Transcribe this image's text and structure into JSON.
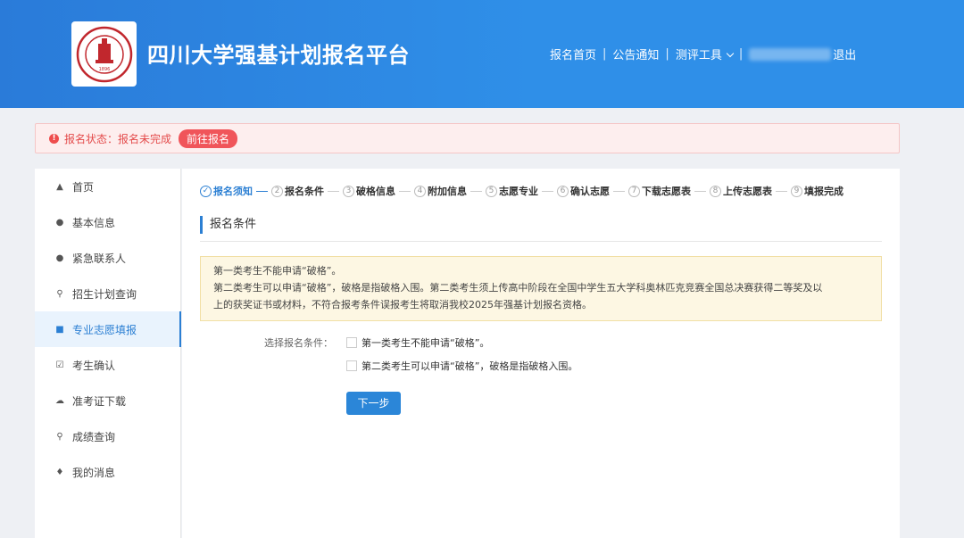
{
  "header": {
    "logo_seal_text": "四川大学 SICHUAN UNIVERSITY 1896",
    "site_title": "四川大学强基计划报名平台",
    "nav": {
      "home": "报名首页",
      "notice": "公告通知",
      "tools": "测评工具",
      "logout": "退出"
    }
  },
  "status": {
    "text": "报名状态：报名未完成",
    "action": "前往报名"
  },
  "sidebar": {
    "items": [
      {
        "label": "首页",
        "icon": "home-icon"
      },
      {
        "label": "基本信息",
        "icon": "user-icon"
      },
      {
        "label": "紧急联系人",
        "icon": "user-icon"
      },
      {
        "label": "招生计划查询",
        "icon": "search-icon"
      },
      {
        "label": "专业志愿填报",
        "icon": "document-icon",
        "active": true
      },
      {
        "label": "考生确认",
        "icon": "checkbox-icon"
      },
      {
        "label": "准考证下载",
        "icon": "cloud-download-icon"
      },
      {
        "label": "成绩查询",
        "icon": "search-icon"
      },
      {
        "label": "我的消息",
        "icon": "bell-icon"
      }
    ]
  },
  "steps": [
    {
      "label": "报名须知",
      "num": "✓",
      "state": "done"
    },
    {
      "label": "报名条件",
      "num": "2"
    },
    {
      "label": "破格信息",
      "num": "3"
    },
    {
      "label": "附加信息",
      "num": "4"
    },
    {
      "label": "志愿专业",
      "num": "5"
    },
    {
      "label": "确认志愿",
      "num": "6"
    },
    {
      "label": "下载志愿表",
      "num": "7"
    },
    {
      "label": "上传志愿表",
      "num": "8"
    },
    {
      "label": "填报完成",
      "num": "9"
    }
  ],
  "section_title": "报名条件",
  "notice": {
    "line1": "第一类考生不能申请“破格”。",
    "line2": "第二类考生可以申请“破格”，破格是指破格入围。第二类考生须上传高中阶段在全国中学生五大学科奥林匹克竞赛全国总决赛获得二等奖及以",
    "line3": "上的获奖证书或材料，不符合报考条件误报考生将取消我校2025年强基计划报名资格。"
  },
  "form": {
    "label": "选择报名条件：",
    "option1": "第一类考生不能申请“破格”。",
    "option2": "第二类考生可以申请“破格”，破格是指破格入围。",
    "next": "下一步"
  },
  "colors": {
    "header_blue": "#2f8fe8",
    "accent": "#2b7fd3",
    "status_red": "#f0555a"
  }
}
